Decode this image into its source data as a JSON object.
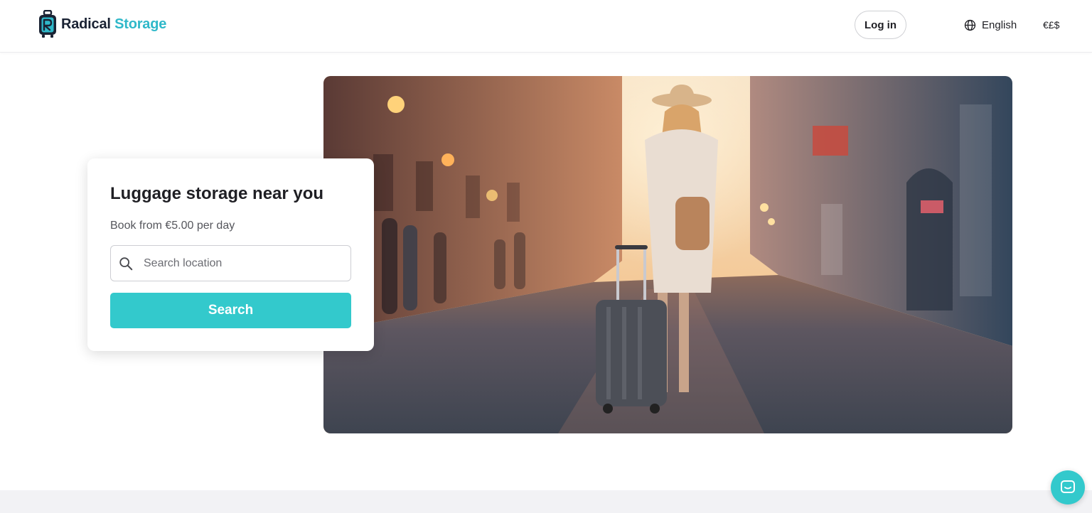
{
  "brand": {
    "name_part1": "Radical",
    "name_part2": "Storage",
    "colors": {
      "dark": "#1a2233",
      "accent": "#2fb8c9"
    },
    "icon": "suitcase-logo-icon"
  },
  "header": {
    "login_label": "Log in",
    "language_label": "English",
    "language_icon": "globe-icon",
    "currency_label": "€£$"
  },
  "hero": {
    "image_alt": "hero-photo-woman-with-suitcase-on-cobblestone-street"
  },
  "search_card": {
    "title": "Luggage storage near you",
    "subtitle": "Book from €5.00 per day",
    "input_placeholder": "Search location",
    "input_value": "",
    "button_label": "Search",
    "button_color": "#33c9cc"
  },
  "chat": {
    "icon": "chat-icon"
  }
}
